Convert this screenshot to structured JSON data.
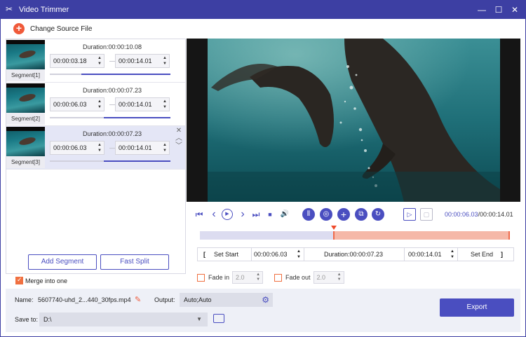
{
  "window": {
    "title": "Video Trimmer",
    "logo_icon": "scissors-icon",
    "minimize_glyph": "—",
    "maximize_glyph": "☐",
    "close_glyph": "✕"
  },
  "toolbar": {
    "change_source_label": "Change Source File",
    "plus_glyph": "+"
  },
  "segments": [
    {
      "label": "Segment[1]",
      "duration": "Duration:00:00:10.08",
      "start": "00:00:03.18",
      "end": "00:00:14.01",
      "progress_start": 0.26,
      "progress_end": 1.0,
      "selected": false
    },
    {
      "label": "Segment[2]",
      "duration": "Duration:00:00:07.23",
      "start": "00:00:06.03",
      "end": "00:00:14.01",
      "progress_start": 0.45,
      "progress_end": 1.0,
      "selected": false
    },
    {
      "label": "Segment[3]",
      "duration": "Duration:00:00:07.23",
      "start": "00:00:06.03",
      "end": "00:00:14.01",
      "progress_start": 0.45,
      "progress_end": 1.0,
      "selected": true
    }
  ],
  "segment_actions": {
    "delete_glyph": "✕",
    "up_glyph": "︿",
    "down_glyph": "﹀"
  },
  "spin_glyphs": {
    "up": "▲",
    "down": "▼"
  },
  "left_buttons": {
    "add_segment": "Add Segment",
    "fast_split": "Fast Split"
  },
  "merge": {
    "label": "Merge into one",
    "checked": true
  },
  "player": {
    "current_time": "00:00:06.03",
    "total_time": "/00:00:14.01",
    "glyphs": {
      "skip_start": "⏮",
      "prev_frame": "‹",
      "play": "▶",
      "next_frame": "›",
      "skip_end": "⏭",
      "stop": "■",
      "volume": "🔊",
      "split": "⫴",
      "snapshot": "◎",
      "add": "+",
      "copy": "⧉",
      "reset": "↻",
      "preview_in": "▷",
      "preview_out": "▢"
    }
  },
  "timeline": {
    "range_start": 0.43,
    "range_end": 1.0,
    "playhead": 0.43
  },
  "edit_row": {
    "open_bracket": "[",
    "set_start": "Set Start",
    "start_time": "00:00:06.03",
    "duration": "Duration:00:00:07.23",
    "end_time": "00:00:14.01",
    "set_end": "Set End",
    "close_bracket": "]"
  },
  "fade": {
    "fade_in_label": "Fade in",
    "fade_in_value": "2.0",
    "fade_out_label": "Fade out",
    "fade_out_value": "2.0"
  },
  "output": {
    "name_label": "Name:",
    "name_value": "5607740-uhd_2...440_30fps.mp4",
    "output_label": "Output:",
    "output_value": "Auto;Auto",
    "save_label": "Save to:",
    "save_value": "D:\\",
    "export_label": "Export"
  },
  "colors": {
    "accent": "#4a4ec0",
    "title_bar": "#3d3fa3",
    "orange": "#f05a3a"
  }
}
